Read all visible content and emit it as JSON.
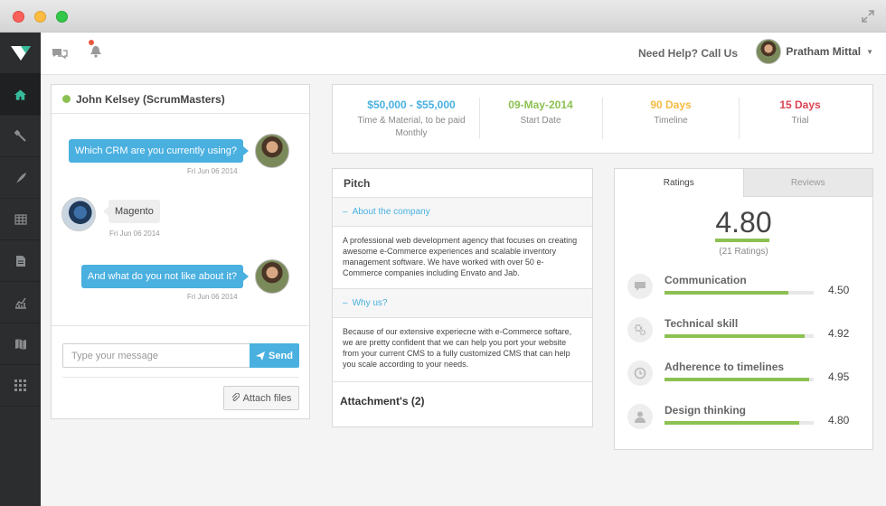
{
  "topbar": {
    "help_text": "Need Help? Call Us",
    "user_name": "Pratham Mittal"
  },
  "sidebar": {
    "items": [
      "home-icon",
      "wrench-icon",
      "feather-icon",
      "table-icon",
      "document-icon",
      "chart-icon",
      "map-icon",
      "grid-icon"
    ],
    "active_item": "home-icon"
  },
  "chat": {
    "contact_name": "John Kelsey (ScrumMasters)",
    "messages": [
      {
        "from": "me",
        "text": "Which CRM are you currently using?",
        "time": "Fri Jun 06 2014"
      },
      {
        "from": "them",
        "text": "Magento",
        "time": "Fri Jun 06 2014"
      },
      {
        "from": "me",
        "text": "And what do you not like about it?",
        "time": "Fri Jun 06 2014"
      }
    ],
    "input_placeholder": "Type your message",
    "send_label": "Send",
    "attach_label": "Attach files"
  },
  "stats": [
    {
      "value": "$50,000 - $55,000",
      "label": "Time & Material, to be paid Monthly",
      "color": "#4ab0e0"
    },
    {
      "value": "09-May-2014",
      "label": "Start Date",
      "color": "#8cc152"
    },
    {
      "value": "90 Days",
      "label": "Timeline",
      "color": "#f6bb42"
    },
    {
      "value": "15 Days",
      "label": "Trial",
      "color": "#da4453"
    }
  ],
  "pitch": {
    "title": "Pitch",
    "sections": [
      {
        "heading": "About the company",
        "body": "A professional web development agency that focuses on creating awesome e-Commerce experiences and scalable inventory management software. We have worked with over 50 e-Commerce companies including Envato and Jab."
      },
      {
        "heading": "Why us?",
        "body": "Because of our extensive experiecne with e-Commerce softare, we are pretty confident that we can help you port your website from your current CMS to a fully customized CMS that can help you scale according to your needs."
      }
    ],
    "attachments_label": "Attachment's (2)"
  },
  "ratings": {
    "tabs": [
      "Ratings",
      "Reviews"
    ],
    "active_tab": "Ratings",
    "overall": "4.80",
    "overall_fraction": 0.96,
    "count_label": "(21 Ratings)",
    "items": [
      {
        "name": "Communication",
        "value": "4.50",
        "fraction": 0.83,
        "icon": "chat-icon"
      },
      {
        "name": "Technical skill",
        "value": "4.92",
        "fraction": 0.94,
        "icon": "gears-icon"
      },
      {
        "name": "Adherence to timelines",
        "value": "4.95",
        "fraction": 0.97,
        "icon": "clock-icon"
      },
      {
        "name": "Design thinking",
        "value": "4.80",
        "fraction": 0.9,
        "icon": "user-icon"
      }
    ]
  },
  "colors": {
    "accent": "#4ab0e0",
    "green": "#8cc152",
    "yellow": "#f6bb42",
    "red": "#da4453",
    "sidebar": "#2b2d2e"
  }
}
